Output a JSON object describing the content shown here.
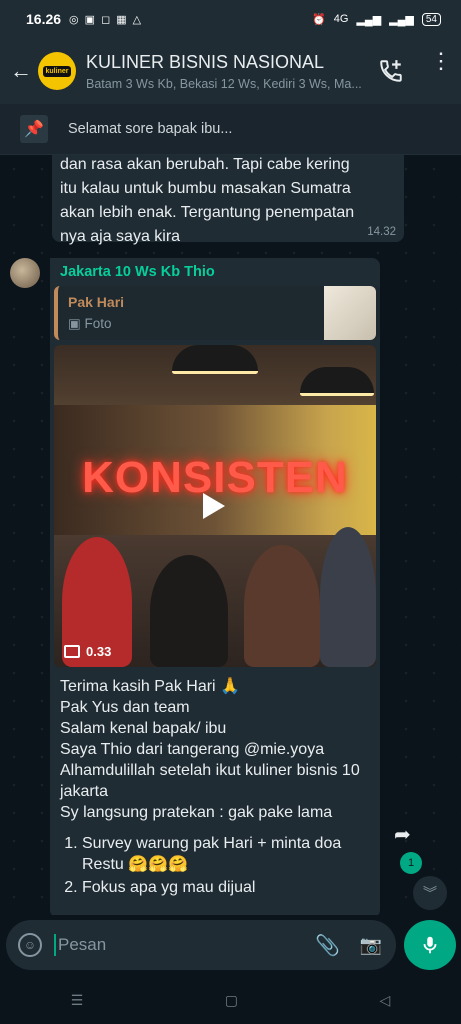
{
  "status": {
    "time": "16.26",
    "battery": "54",
    "network": "4G"
  },
  "header": {
    "title": "KULINER BISNIS NASIONAL",
    "subtitle": "Batam 3 Ws Kb, Bekasi 12 Ws, Kediri 3 Ws, Ma...",
    "avatar_text": "kuliner"
  },
  "pinned": {
    "text": "Selamat sore bapak ibu..."
  },
  "messages": {
    "m1": {
      "text": "dan rasa akan berubah. Tapi cabe kering\nitu kalau untuk bumbu masakan Sumatra\nakan lebih enak. Tergantung penempatan\nnya aja saya kira",
      "time": "14.32"
    },
    "m2": {
      "sender": "Jakarta 10 Ws Kb Thio",
      "quote_name": "Pak Hari",
      "quote_type": "Foto",
      "video_overlay_text": "KONSISTEN",
      "video_duration": "0.33",
      "lines": [
        "Terima kasih Pak Hari 🙏",
        "Pak Yus dan team",
        "Salam kenal bapak/ ibu",
        "Saya Thio dari tangerang @mie.yoya",
        "Alhamdulillah setelah ikut kuliner bisnis 10 jakarta",
        "Sy langsung pratekan :  gak pake lama"
      ],
      "list": [
        "Survey warung pak Hari + minta doa Restu 🤗🤗🤗",
        "Fokus apa yg mau dijual"
      ]
    }
  },
  "unread_count": "1",
  "input": {
    "placeholder": "Pesan"
  },
  "colors": {
    "accent": "#00a884",
    "sender": "#06cf9c",
    "quote": "#c08a5b"
  }
}
